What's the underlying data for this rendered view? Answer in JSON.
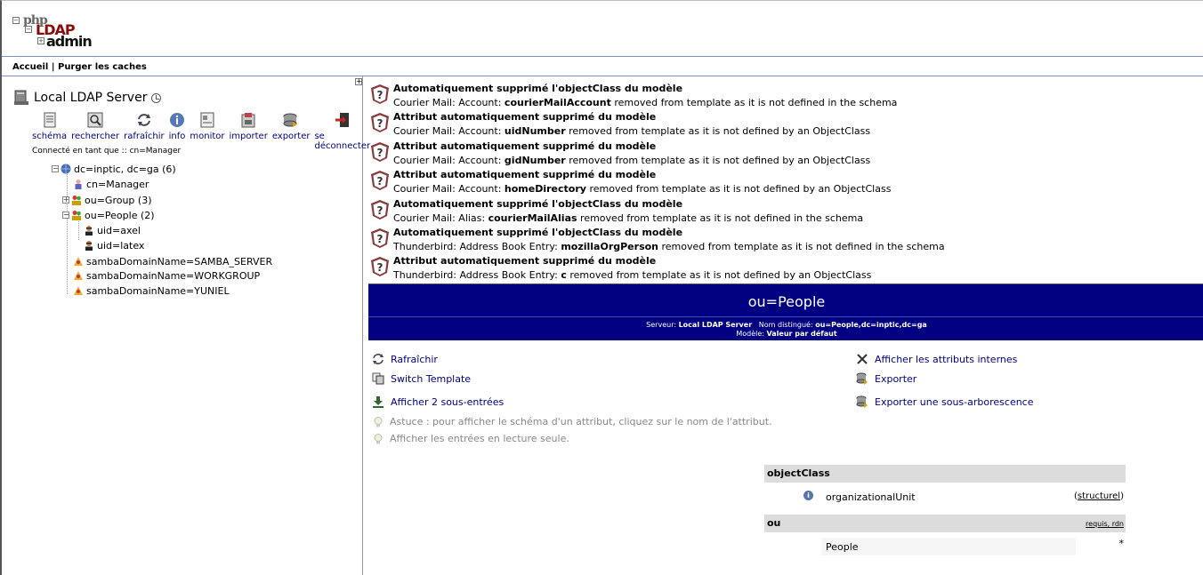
{
  "logo": {
    "php": "php",
    "ldap": "LDAP",
    "admin": "admin"
  },
  "nav": {
    "home": "Accueil",
    "separator": "|",
    "purge": "Purger les caches"
  },
  "server": {
    "name": "Local LDAP Server"
  },
  "tools": [
    {
      "label": "schéma",
      "icon": "schema-icon"
    },
    {
      "label": "rechercher",
      "icon": "search-icon"
    },
    {
      "label": "rafraîchir",
      "icon": "refresh-icon"
    },
    {
      "label": "info",
      "icon": "info-icon"
    },
    {
      "label": "monitor",
      "icon": "monitor-icon"
    },
    {
      "label": "importer",
      "icon": "import-icon"
    },
    {
      "label": "exporter",
      "icon": "export-icon"
    },
    {
      "label": "se déconnecter",
      "icon": "logout-icon"
    }
  ],
  "connected": "Connecté en tant que :: cn=Manager",
  "tree": [
    {
      "label": "dc=inptic, dc=ga (6)"
    },
    {
      "label": "cn=Manager"
    },
    {
      "label": "ou=Group (3)"
    },
    {
      "label": "ou=People (2)"
    },
    {
      "label": "uid=axel"
    },
    {
      "label": "uid=latex"
    },
    {
      "label": "sambaDomainName=SAMBA_SERVER"
    },
    {
      "label": "sambaDomainName=WORKGROUP"
    },
    {
      "label": "sambaDomainName=YUNIEL"
    }
  ],
  "messages": [
    {
      "title": "Automatiquement supprimé l'objectClass du modèle",
      "prefix": "Courier Mail: Account: ",
      "key": "courierMailAccount",
      "suffix": " removed from template as it is not defined in the schema"
    },
    {
      "title": "Attribut automatiquement supprimé du modèle",
      "prefix": "Courier Mail: Account: ",
      "key": "uidNumber",
      "suffix": " removed from template as it is not defined by an ObjectClass"
    },
    {
      "title": "Attribut automatiquement supprimé du modèle",
      "prefix": "Courier Mail: Account: ",
      "key": "gidNumber",
      "suffix": " removed from template as it is not defined by an ObjectClass"
    },
    {
      "title": "Attribut automatiquement supprimé du modèle",
      "prefix": "Courier Mail: Account: ",
      "key": "homeDirectory",
      "suffix": " removed from template as it is not defined by an ObjectClass"
    },
    {
      "title": "Automatiquement supprimé l'objectClass du modèle",
      "prefix": "Courier Mail: Alias: ",
      "key": "courierMailAlias",
      "suffix": " removed from template as it is not defined in the schema"
    },
    {
      "title": "Automatiquement supprimé l'objectClass du modèle",
      "prefix": "Thunderbird: Address Book Entry: ",
      "key": "mozillaOrgPerson",
      "suffix": " removed from template as it is not defined in the schema"
    },
    {
      "title": "Attribut automatiquement supprimé du modèle",
      "prefix": "Thunderbird: Address Book Entry: ",
      "key": "c",
      "suffix": " removed from template as it is not defined by an ObjectClass"
    }
  ],
  "banner": {
    "title": "ou=People",
    "server_label": "Serveur:",
    "server_value": "Local LDAP Server",
    "dn_label": "Nom distingué:",
    "dn_value": "ou=People,dc=inptic,dc=ga",
    "template_label": "Modèle:",
    "template_value": "Valeur par défaut"
  },
  "actions": {
    "refresh": "Rafraîchir",
    "switch_template": "Switch Template",
    "show_children": "Afficher 2 sous-entrées",
    "internal_attrs": "Afficher les attributs internes",
    "export": "Exporter",
    "export_subtree": "Exporter une sous-arborescence"
  },
  "hints": {
    "schema_tip": "Astuce : pour afficher le schéma d'un attribut, cliquez sur le nom de l'attribut.",
    "readonly": "Afficher les entrées en lecture seule."
  },
  "attributes": {
    "objectclass": {
      "name": "objectClass",
      "value": "organizationalUnit",
      "tag": "structurel"
    },
    "ou": {
      "name": "ou",
      "meta_required": "requis",
      "meta_rdn": "rdn",
      "value": "People",
      "star": "*"
    }
  },
  "colors": {
    "banner": "#000080",
    "link": "#000080",
    "logo_ldap": "#8a0b0b"
  }
}
